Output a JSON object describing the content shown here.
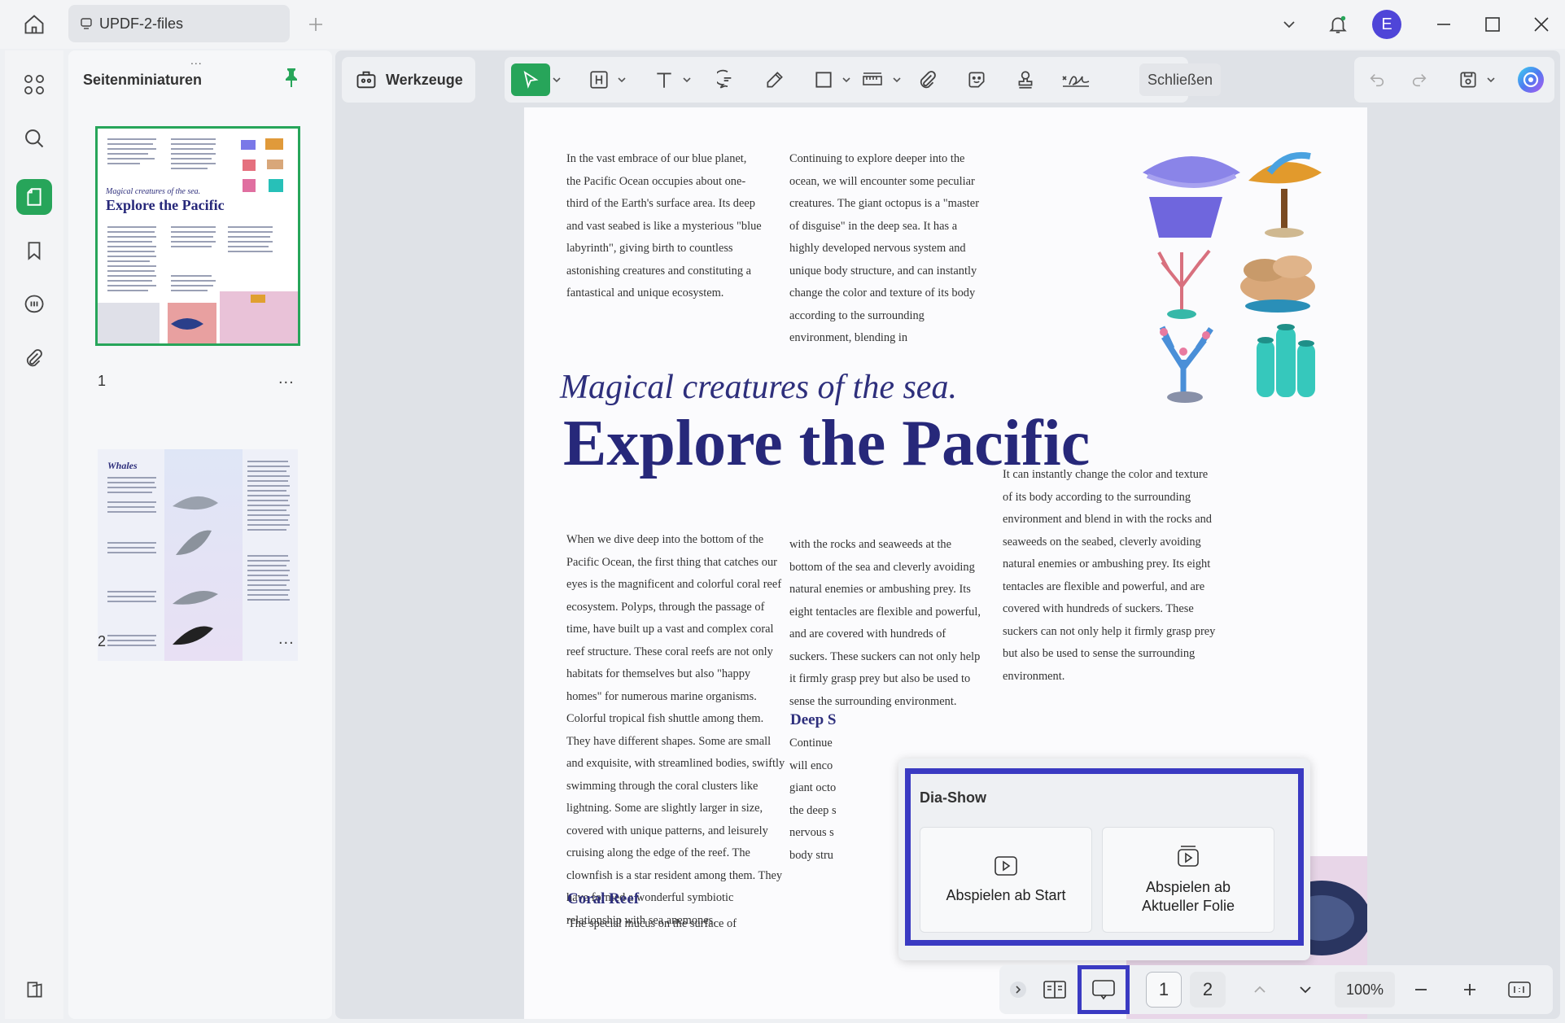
{
  "app": {
    "file_tab_title": "UPDF-2-files",
    "avatar_letter": "E"
  },
  "thumbnails": {
    "title": "Seitenminiaturen",
    "grip": "...",
    "pages": [
      {
        "number": "1",
        "more": "...",
        "title": "Explore the Pacific",
        "subtitle": "Magical creatures of the sea."
      },
      {
        "number": "2",
        "more": "...",
        "title": "Whales"
      }
    ]
  },
  "toolbar": {
    "tools_label": "Werkzeuge",
    "close_label": "Schließen"
  },
  "document": {
    "col1_intro": "In the vast embrace of our blue planet, the Pacific Ocean occupies about one-third of the Earth's surface area. Its deep and vast seabed is like a mysterious \"blue labyrinth\", giving birth to countless astonishing creatures and constituting a fantastical and unique ecosystem.",
    "col2_intro": "Continuing to explore deeper into the ocean, we will encounter some peculiar creatures. The giant octopus is a \"master of disguise\" in the deep sea. It has a highly developed nervous system and unique body structure, and can instantly change the color and texture of its body according to the surrounding environment, blending in",
    "subtitle": "Magical creatures of the sea.",
    "title": "Explore the Pacific",
    "col3_text": "It can instantly change the color and texture of its body according to the surrounding environment and blend in with the rocks and seaweeds on the seabed, cleverly avoiding natural enemies or ambushing prey. Its eight tentacles are flexible and powerful, and are covered with hundreds of suckers. These suckers can not only help it firmly grasp prey but also be used to sense the surrounding environment.",
    "col1_body": "When we dive deep into the bottom of the Pacific Ocean, the first thing that catches our eyes is the magnificent and colorful coral reef ecosystem. Polyps, through the passage of time, have built up a vast and complex coral reef structure. These coral reefs are not only habitats for themselves but also \"happy homes\" for numerous marine organisms. Colorful tropical fish shuttle among them. They have different shapes. Some are small and exquisite, with streamlined bodies, swiftly swimming through the coral clusters like lightning. Some are slightly larger in size, covered with unique patterns, and leisurely cruising along the edge of the reef. The clownfish is a star resident among them. They have formed a wonderful symbiotic relationship with sea anemones.",
    "col2_body": "with the rocks and seaweeds at the bottom of the sea and cleverly avoiding natural enemies or ambushing prey. Its eight tentacles are flexible and powerful, and are covered with hundreds of suckers. These suckers can not only help it firmly grasp prey but also be used to sense the surrounding environment.",
    "deep_sea_heading": "Deep S",
    "deep_sea_lines": "Continue\nwill enco\ngiant octo\nthe deep s\nnervous s\nbody stru",
    "coral_heading": "Coral Reef",
    "coral_first_line": "The special mucus on the surface of"
  },
  "slideshow_popup": {
    "title": "Dia-Show",
    "play_from_start": "Abspielen ab Start",
    "play_from_current": "Abspielen ab\nAktueller Folie"
  },
  "bottombar": {
    "page_1": "1",
    "page_2": "2",
    "zoom": "100%"
  },
  "colors": {
    "accent_green": "#27a55a",
    "highlight_blue": "#3a3ac2",
    "title_navy": "#27287a",
    "avatar_purple": "#4f45d8"
  },
  "icons": [
    "home-icon",
    "file-icon",
    "plus-icon",
    "chevron-down-icon",
    "bell-icon",
    "minimize-icon",
    "maximize-icon",
    "close-icon",
    "thumbnails-icon",
    "search-icon",
    "pages-icon",
    "bookmark-icon",
    "comment-icon",
    "attachment-icon",
    "layers-icon",
    "pin-icon",
    "toolbox-icon",
    "select-icon",
    "highlight-icon",
    "text-icon",
    "comment-icon",
    "pen-icon",
    "shape-icon",
    "measure-icon",
    "paperclip-icon",
    "sticker-icon",
    "stamp-icon",
    "signature-icon",
    "undo-icon",
    "redo-icon",
    "save-icon",
    "ai-assistant-icon",
    "play-icon",
    "slideshow-icon",
    "page-layout-icon",
    "chevron-up-icon",
    "zoom-out-icon",
    "zoom-in-icon",
    "fit-icon"
  ]
}
